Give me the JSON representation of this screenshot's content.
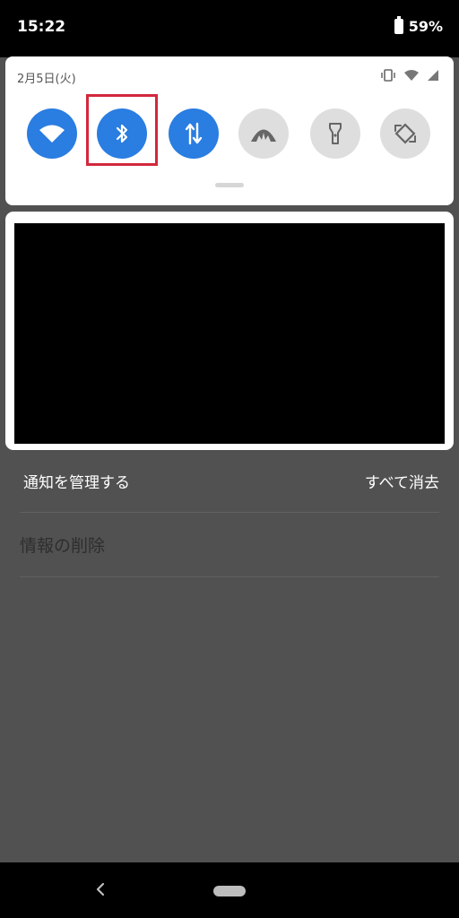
{
  "status_bar": {
    "time": "15:22",
    "battery_percent": "59%"
  },
  "quick_settings": {
    "date": "2月5日(火)",
    "tiles": [
      {
        "name": "wifi",
        "icon": "wifi-icon",
        "state": "on"
      },
      {
        "name": "bluetooth",
        "icon": "bluetooth-icon",
        "state": "on",
        "highlighted": true
      },
      {
        "name": "mobile-data",
        "icon": "data-arrows-icon",
        "state": "on"
      },
      {
        "name": "hotspot",
        "icon": "hotspot-icon",
        "state": "off"
      },
      {
        "name": "flashlight",
        "icon": "flashlight-icon",
        "state": "off"
      },
      {
        "name": "auto-rotate",
        "icon": "rotate-icon",
        "state": "off"
      }
    ],
    "colors": {
      "tile_on": "#2a7de1",
      "tile_off": "#dedede",
      "highlight": "#d2283c"
    }
  },
  "notifications": {
    "manage_label": "通知を管理する",
    "clear_all_label": "すべて消去"
  },
  "background_app": {
    "item_label": "情報の削除"
  }
}
